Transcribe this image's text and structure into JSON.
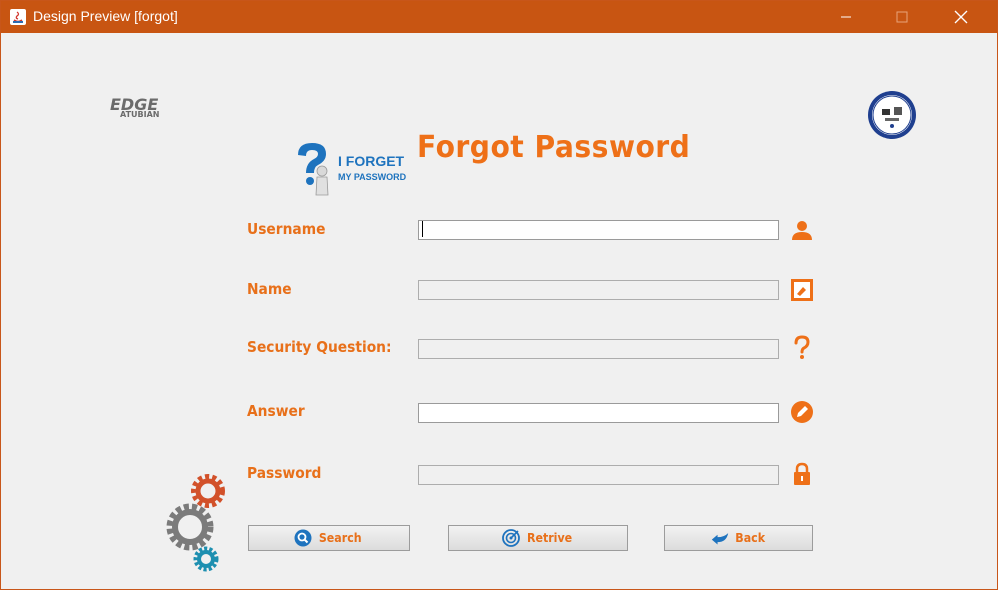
{
  "window": {
    "title": "Design Preview [forgot]",
    "controls": [
      "minimize-icon",
      "maximize-icon",
      "close-icon"
    ],
    "titlebar_color": "#c85512"
  },
  "branding": {
    "logo_top": "EDGE",
    "logo_bottom": "ATUBIAN",
    "seal_icon": "university-seal-icon",
    "forget_line1": "I FORGET",
    "forget_line2": "MY PASSWORD"
  },
  "heading": "Forgot Password",
  "form": {
    "username_label": "Username",
    "name_label": "Name",
    "security_label": "Security Question:",
    "answer_label": "Answer",
    "password_label": "Password",
    "username_value": "",
    "name_value": "",
    "security_value": "",
    "answer_value": "",
    "password_value": ""
  },
  "icons": {
    "username": "user-icon",
    "name": "id-card-icon",
    "security": "question-mark-icon",
    "answer": "pencil-icon",
    "password": "lock-icon"
  },
  "buttons": {
    "search": "Search",
    "retrive": "Retrive",
    "back": "Back"
  },
  "colors": {
    "accent": "#e8701a",
    "title_orange": "#ee7018",
    "blue": "#1e73be"
  }
}
